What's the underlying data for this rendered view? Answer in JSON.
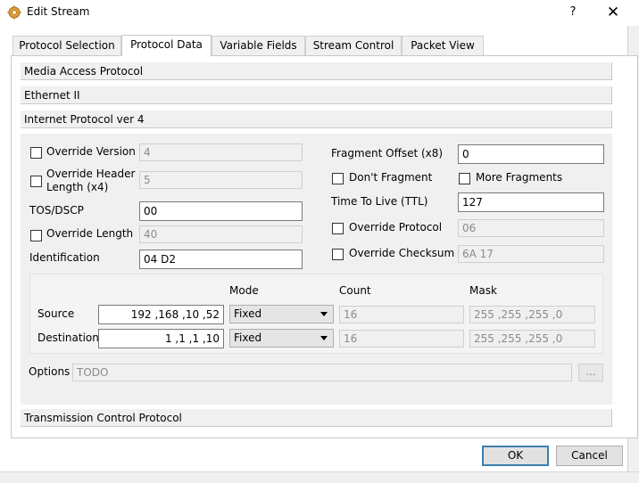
{
  "window": {
    "title": "Edit Stream",
    "help_label": "?",
    "close_label": "✕"
  },
  "tabs": [
    {
      "label": "Protocol Selection",
      "active": false
    },
    {
      "label": "Protocol Data",
      "active": true
    },
    {
      "label": "Variable Fields",
      "active": false
    },
    {
      "label": "Stream Control",
      "active": false
    },
    {
      "label": "Packet View",
      "active": false
    }
  ],
  "sections": {
    "mac": "Media Access Protocol",
    "ethernet": "Ethernet II",
    "ipv4": "Internet Protocol ver 4",
    "tcp": "Transmission Control Protocol"
  },
  "ipv4": {
    "override_version_label": "Override Version",
    "version_value": "4",
    "override_header_length_label": "Override Header\nLength (x4)",
    "header_length_value": "5",
    "tos_label": "TOS/DSCP",
    "tos_value": "00",
    "override_length_label": "Override Length",
    "length_value": "40",
    "identification_label": "Identification",
    "identification_value": "04 D2",
    "fragment_offset_label": "Fragment Offset (x8)",
    "fragment_offset_value": "0",
    "dont_fragment_label": "Don't Fragment",
    "more_fragments_label": "More Fragments",
    "ttl_label": "Time To Live (TTL)",
    "ttl_value": "127",
    "override_protocol_label": "Override Protocol",
    "protocol_value": "06",
    "override_checksum_label": "Override Checksum",
    "checksum_value": "6A 17"
  },
  "address": {
    "mode_header": "Mode",
    "count_header": "Count",
    "mask_header": "Mask",
    "source_label": "Source",
    "source_ip": "192 ,168 ,10 ,52",
    "source_mode": "Fixed",
    "source_count": "16",
    "source_mask": "255 ,255 ,255 ,0",
    "destination_label": "Destination",
    "destination_ip": "1 ,1 ,1 ,10",
    "destination_mode": "Fixed",
    "destination_count": "16",
    "destination_mask": "255 ,255 ,255 ,0"
  },
  "options": {
    "label": "Options",
    "value": "TODO",
    "browse_label": "..."
  },
  "buttons": {
    "ok": "OK",
    "cancel": "Cancel"
  },
  "colors": {
    "default_button_border": "#3c7fb1",
    "panel_background": "#f0f0f0"
  }
}
